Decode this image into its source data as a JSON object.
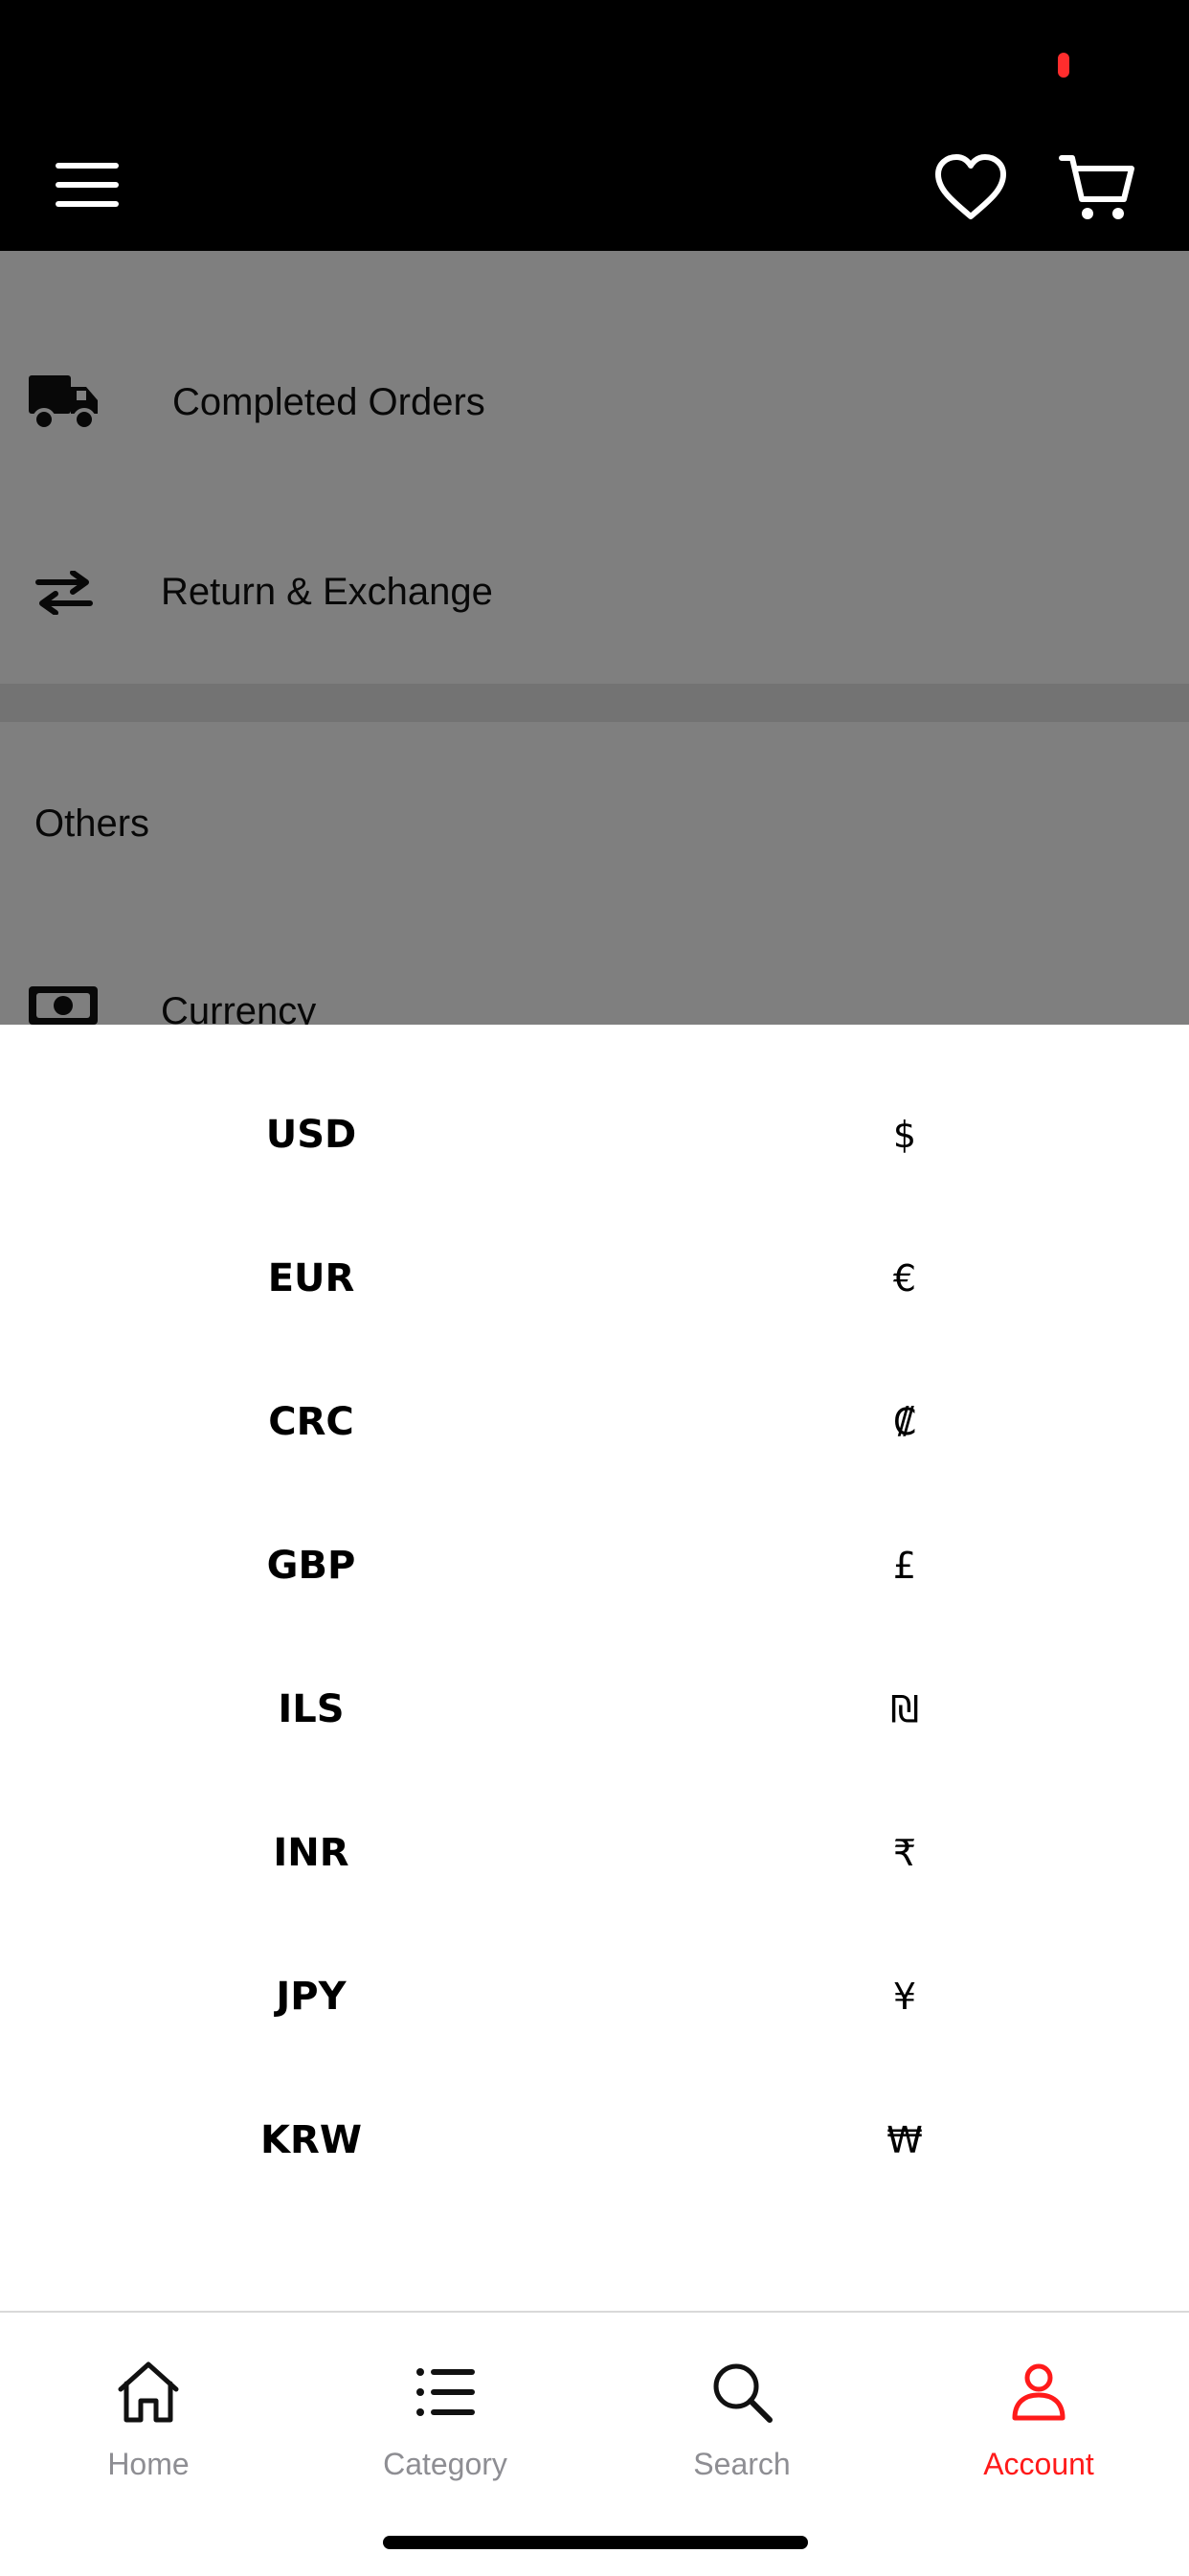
{
  "header": {
    "menu_icon": "hamburger-icon",
    "wishlist_icon": "heart-icon",
    "cart_icon": "cart-icon",
    "status_indicator_color": "#ff2d2d"
  },
  "background_page": {
    "orders": [
      {
        "icon": "truck-icon",
        "label": "Completed Orders"
      },
      {
        "icon": "swap-arrows-icon",
        "label": "Return & Exchange"
      }
    ],
    "others_heading": "Others",
    "currency_row": {
      "icon": "banknote-icon",
      "label": "Currency"
    }
  },
  "currency_sheet": {
    "items": [
      {
        "code": "USD",
        "symbol": "$"
      },
      {
        "code": "EUR",
        "symbol": "€"
      },
      {
        "code": "CRC",
        "symbol": "₡"
      },
      {
        "code": "GBP",
        "symbol": "£"
      },
      {
        "code": "ILS",
        "symbol": "₪"
      },
      {
        "code": "INR",
        "symbol": "₹"
      },
      {
        "code": "JPY",
        "symbol": "¥"
      },
      {
        "code": "KRW",
        "symbol": "₩"
      }
    ]
  },
  "bottom_nav": {
    "items": [
      {
        "label": "Home",
        "icon": "home-icon",
        "active": false
      },
      {
        "label": "Category",
        "icon": "list-icon",
        "active": false
      },
      {
        "label": "Search",
        "icon": "search-icon",
        "active": false
      },
      {
        "label": "Account",
        "icon": "user-icon",
        "active": true
      }
    ],
    "active_color": "#ff1a1a",
    "inactive_color": "#8e8e93"
  }
}
